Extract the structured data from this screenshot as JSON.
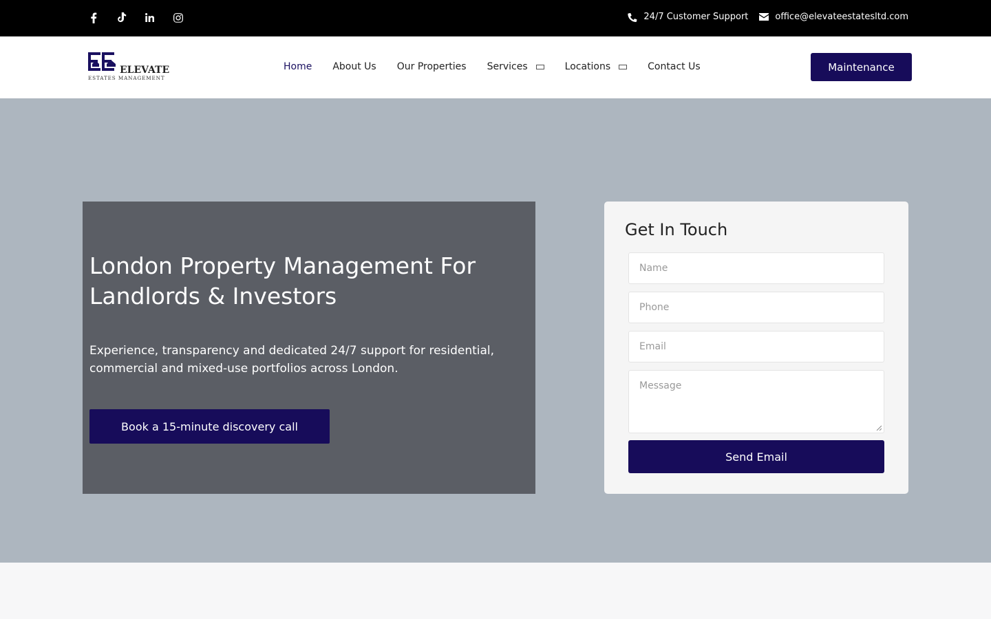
{
  "topbar": {
    "social": [
      {
        "icon": "facebook-icon"
      },
      {
        "icon": "tiktok-icon"
      },
      {
        "icon": "linkedin-icon"
      },
      {
        "icon": "instagram-icon"
      }
    ],
    "support_label": "24/7 Customer Support",
    "email_label": "office@elevateestatesltd.com"
  },
  "header": {
    "logo_text": "ELEVATE",
    "logo_subtext": "ESTATES MANAGEMENT",
    "nav": {
      "home": "Home",
      "about": "About Us",
      "properties": "Our Properties",
      "services": "Services",
      "locations": "Locations",
      "contact": "Contact Us"
    },
    "maintenance_label": "Maintenance"
  },
  "hero": {
    "title": "London Property Management For Landlords & Investors",
    "description": "Experience, transparency and dedicated 24/7 support for residential, commercial and mixed-use portfolios across London.",
    "cta_label": "Book a 15-minute discovery call"
  },
  "form": {
    "title": "Get In Touch",
    "name_placeholder": "Name",
    "phone_placeholder": "Phone",
    "email_placeholder": "Email",
    "message_placeholder": "Message",
    "send_label": "Send Email"
  },
  "colors": {
    "brand": "#170c5a",
    "topbar": "#000000",
    "hero_bg": "#adb6bf",
    "hero_panel": "#5b5e65"
  }
}
